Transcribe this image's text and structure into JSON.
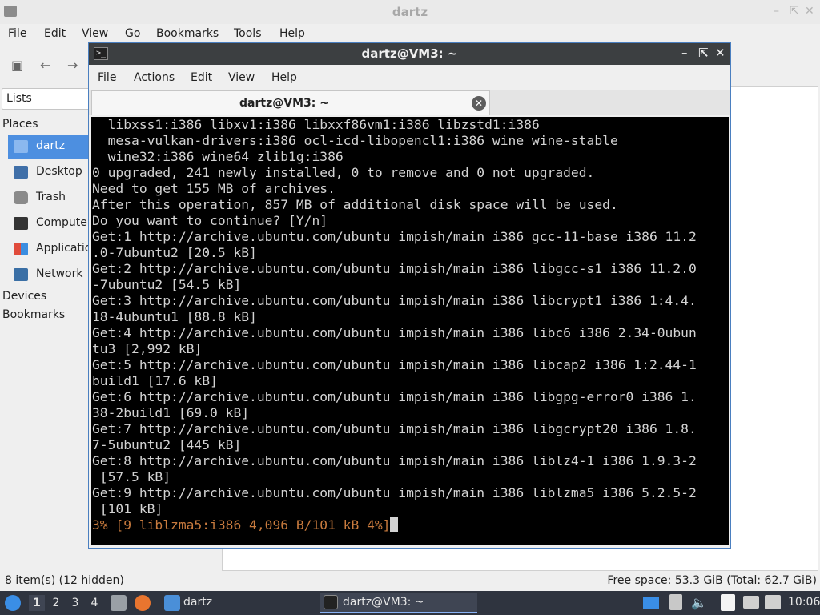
{
  "file_manager": {
    "title": "dartz",
    "menu": [
      "File",
      "Edit",
      "View",
      "Go",
      "Bookmarks",
      "Tools",
      "Help"
    ],
    "lists_label": "Lists",
    "places_heading": "Places",
    "places": [
      "dartz",
      "Desktop",
      "Trash",
      "Computer",
      "Applications",
      "Network"
    ],
    "devices_heading": "Devices",
    "bookmarks_heading": "Bookmarks",
    "status_left": "8 item(s) (12 hidden)",
    "status_right": "Free space: 53.3 GiB (Total: 62.7 GiB)"
  },
  "terminal": {
    "title": "dartz@VM3: ~",
    "menu": [
      "File",
      "Actions",
      "Edit",
      "View",
      "Help"
    ],
    "tab_label": "dartz@VM3: ~",
    "lines": [
      "  libxss1:i386 libxv1:i386 libxxf86vm1:i386 libzstd1:i386",
      "  mesa-vulkan-drivers:i386 ocl-icd-libopencl1:i386 wine wine-stable",
      "  wine32:i386 wine64 zlib1g:i386",
      "0 upgraded, 241 newly installed, 0 to remove and 0 not upgraded.",
      "Need to get 155 MB of archives.",
      "After this operation, 857 MB of additional disk space will be used.",
      "Do you want to continue? [Y/n]",
      "Get:1 http://archive.ubuntu.com/ubuntu impish/main i386 gcc-11-base i386 11.2",
      ".0-7ubuntu2 [20.5 kB]",
      "Get:2 http://archive.ubuntu.com/ubuntu impish/main i386 libgcc-s1 i386 11.2.0",
      "-7ubuntu2 [54.5 kB]",
      "Get:3 http://archive.ubuntu.com/ubuntu impish/main i386 libcrypt1 i386 1:4.4.",
      "18-4ubuntu1 [88.8 kB]",
      "Get:4 http://archive.ubuntu.com/ubuntu impish/main i386 libc6 i386 2.34-0ubun",
      "tu3 [2,992 kB]",
      "Get:5 http://archive.ubuntu.com/ubuntu impish/main i386 libcap2 i386 1:2.44-1",
      "build1 [17.6 kB]",
      "Get:6 http://archive.ubuntu.com/ubuntu impish/main i386 libgpg-error0 i386 1.",
      "38-2build1 [69.0 kB]",
      "Get:7 http://archive.ubuntu.com/ubuntu impish/main i386 libgcrypt20 i386 1.8.",
      "7-5ubuntu2 [445 kB]",
      "Get:8 http://archive.ubuntu.com/ubuntu impish/main i386 liblz4-1 i386 1.9.3-2",
      " [57.5 kB]",
      "Get:9 http://archive.ubuntu.com/ubuntu impish/main i386 liblzma5 i386 5.2.5-2",
      " [101 kB]"
    ],
    "progress_line": "3% [9 liblzma5:i386 4,096 B/101 kB 4%]"
  },
  "taskbar": {
    "workspaces": [
      "1",
      "2",
      "3",
      "4"
    ],
    "task_files": "dartz",
    "task_terminal": "dartz@VM3: ~",
    "clock": "10:06"
  },
  "colors": {
    "selection": "#4d8fe0",
    "terminal_bg": "#000000",
    "terminal_fg": "#d3d3d3",
    "progress_fg": "#c97b3e",
    "taskbar_bg": "#2f343f"
  }
}
